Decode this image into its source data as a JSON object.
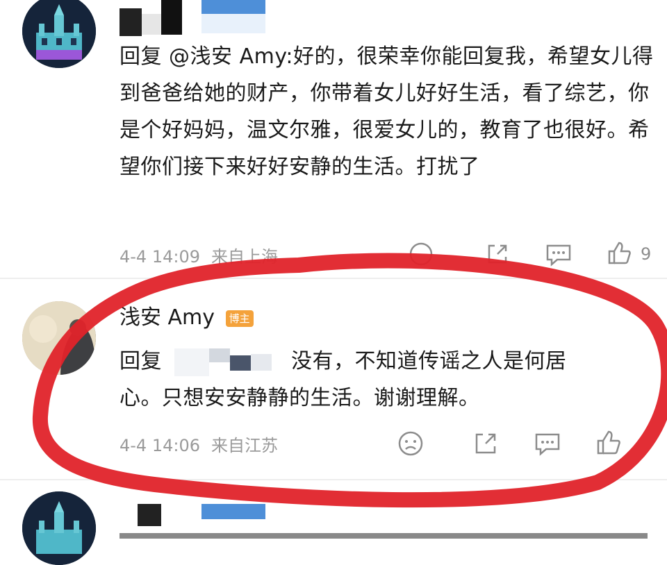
{
  "comment1": {
    "body": "回复 @浅安 Amy:好的，很荣幸你能回复我，希望女儿得到爸爸给她的财产，你带着女儿好好生活，看了综艺，你是个好妈妈，温文尔雅，很爱女儿的，教育了也很好。希望你们接下来好好安静的生活。打扰了",
    "timestamp": "4-4 14:09",
    "location": "来自上海",
    "like_count": "9"
  },
  "comment2": {
    "username": "浅安 Amy",
    "badge": "博主",
    "reply_prefix": "回复",
    "body": "没有，不知道传谣之人是何居",
    "body_line2": "心。只想安安静静的生活。谢谢理解。",
    "timestamp": "4-4 14:06",
    "location": "来自江苏"
  },
  "colors": {
    "highlight_circle": "#e0232a",
    "badge": "#f4a23b",
    "meta_text": "#9a9a9a"
  }
}
